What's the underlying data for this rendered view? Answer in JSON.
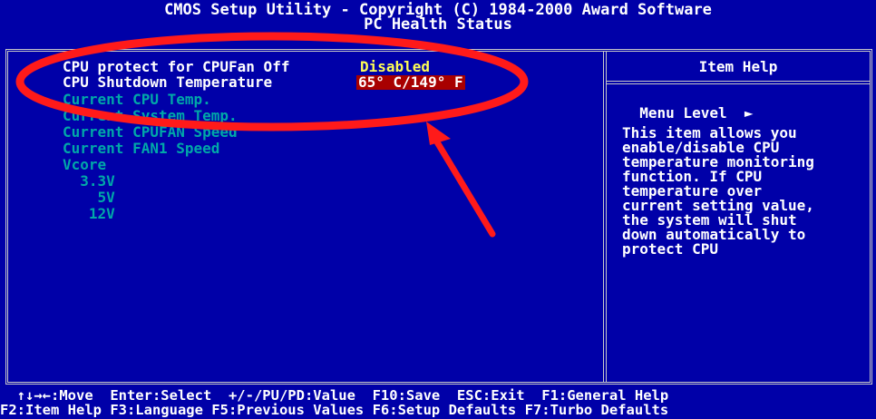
{
  "header": {
    "title": "CMOS Setup Utility - Copyright (C) 1984-2000 Award Software",
    "subtitle": "PC Health Status"
  },
  "settings": [
    {
      "label": "CPU protect for CPUFan Off",
      "value": "Disabled"
    },
    {
      "label": "CPU Shutdown Temperature",
      "value": "65° C/149° F"
    }
  ],
  "readouts": [
    "Current CPU Temp.",
    "Current System Temp.",
    "Current CPUFAN Speed",
    "Current FAN1 Speed",
    "Vcore",
    "  3.3V",
    "    5V",
    "   12V"
  ],
  "help": {
    "title": "Item Help",
    "menu_level": "Menu Level",
    "menu_level_icon": "right-triangle-icon",
    "lines": [
      "This item allows you",
      "enable/disable CPU",
      "temperature monitoring",
      "function. If CPU",
      "temperature over",
      "current setting value,",
      "the system will shut",
      "down automatically to",
      "protect CPU"
    ]
  },
  "footer": {
    "line1": "  ↑↓→←:Move  Enter:Select  +/-/PU/PD:Value  F10:Save  ESC:Exit  F1:General Help",
    "line2": "F2:Item Help F3:Language F5:Previous Values F6:Setup Defaults F7:Turbo Defaults"
  },
  "colors": {
    "background": "#0000a8",
    "selected_value_bg": "#a80000",
    "value_text": "#ffff54",
    "inactive_text": "#00a8a8",
    "annotation": "#ff1a1a"
  }
}
